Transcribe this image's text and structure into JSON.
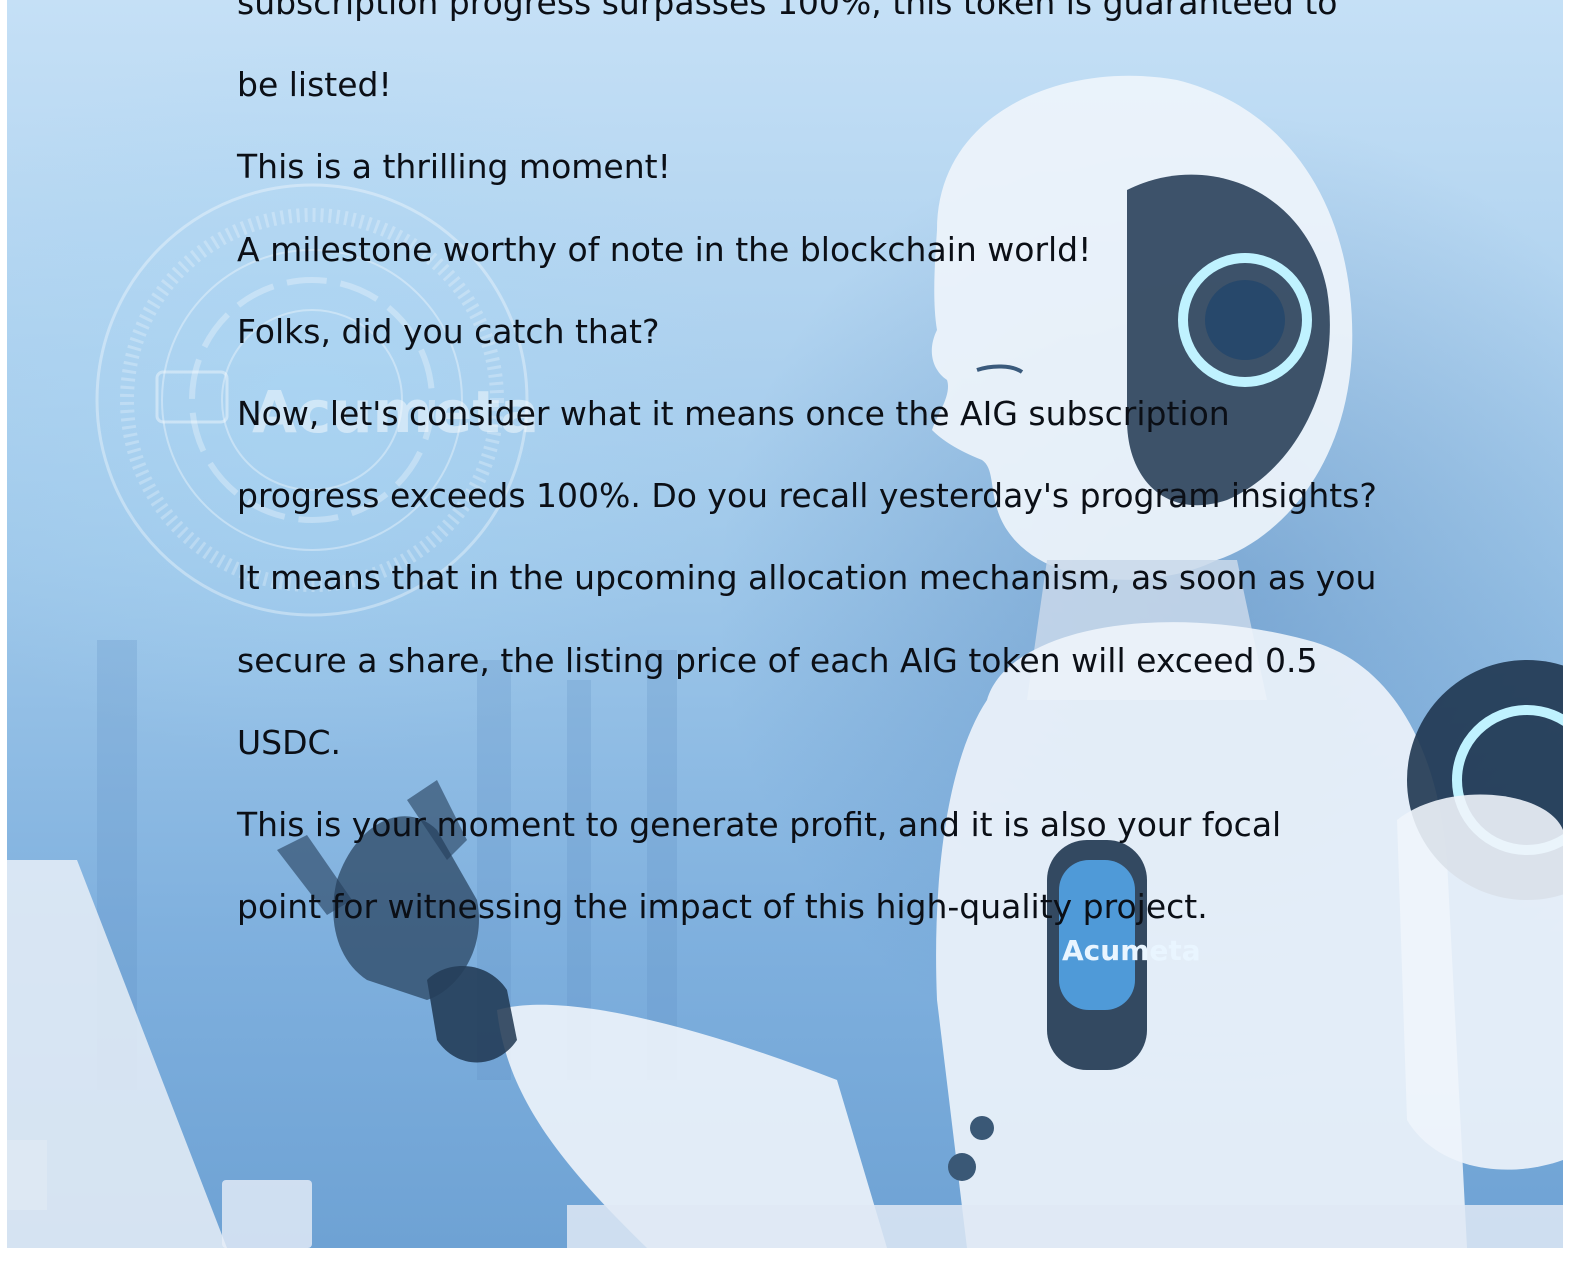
{
  "background": {
    "logos": [
      "Acumeta",
      "Acumeta"
    ],
    "colors": {
      "sky_light": "#c5e0f6",
      "sky_mid": "#9fc8ea",
      "deep": "#6ea2d4",
      "robot_white": "#eef4fb",
      "robot_dark": "#1f3650",
      "glow": "#bff2ff"
    }
  },
  "document": {
    "lines": [
      "subscription progress surpasses 100%, this token is guaranteed to",
      "be listed!",
      "This is a thrilling moment!",
      "A milestone worthy of note in the blockchain world!",
      "Folks, did you catch that?",
      "Now, let's consider what it means once the AIG subscription",
      "progress exceeds 100%. Do you recall yesterday's program insights?",
      "It means that in the upcoming allocation mechanism, as soon as you",
      "secure a share, the listing price of each AIG token will exceed 0.5",
      "USDC.",
      "This is your moment to generate profit, and it is also your focal",
      "point for witnessing the impact of this high-quality project."
    ]
  }
}
